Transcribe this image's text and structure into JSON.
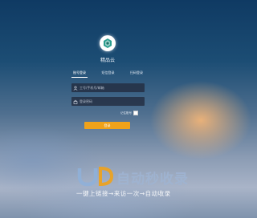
{
  "app": {
    "name": "精品云"
  },
  "tabs": [
    {
      "label": "账号登录",
      "active": true
    },
    {
      "label": "短信登录",
      "active": false
    },
    {
      "label": "扫码登录",
      "active": false
    }
  ],
  "form": {
    "username_placeholder": "工号/手机号/邮箱",
    "password_placeholder": "登录密码",
    "remember_label": "记住账号",
    "remember_checked": false,
    "login_label": "登录"
  },
  "watermark": {
    "title": "自动秒收录",
    "subtitle": "一键上链接→来访一次→自动收录",
    "logo_icon": "ZDM-logo-icon"
  },
  "colors": {
    "accent": "#f0a21a",
    "input_bg": "#232d41",
    "logo_green": "#2a9d8f"
  },
  "icons": {
    "user": "user-icon",
    "lock": "lock-icon",
    "logo": "cloud-logo-icon"
  }
}
